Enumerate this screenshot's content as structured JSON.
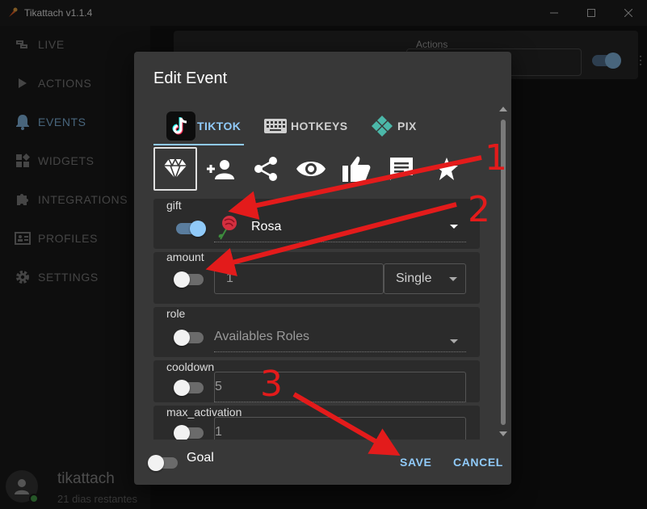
{
  "window": {
    "title": "Tikattach v1.1.4"
  },
  "sidebar": {
    "items": [
      {
        "label": "LIVE",
        "icon": "live-icon"
      },
      {
        "label": "ACTIONS",
        "icon": "play-icon"
      },
      {
        "label": "EVENTS",
        "icon": "bell-icon",
        "active": true
      },
      {
        "label": "WIDGETS",
        "icon": "widgets-icon"
      },
      {
        "label": "INTEGRATIONS",
        "icon": "puzzle-icon"
      },
      {
        "label": "PROFILES",
        "icon": "profile-card-icon"
      },
      {
        "label": "SETTINGS",
        "icon": "gear-icon"
      }
    ],
    "user": {
      "name": "tikattach",
      "info": "21 dias restantes"
    }
  },
  "background": {
    "actions_label": "Actions"
  },
  "dialog": {
    "title": "Edit Event",
    "tabs": [
      {
        "label": "TIKTOK",
        "active": true
      },
      {
        "label": "HOTKEYS"
      },
      {
        "label": "PIX"
      }
    ],
    "fields": {
      "gift": {
        "label": "gift",
        "value": "Rosa",
        "enabled": true
      },
      "amount": {
        "label": "amount",
        "value": "1",
        "mode": "Single",
        "enabled": false
      },
      "role": {
        "label": "role",
        "placeholder": "Availables Roles",
        "enabled": false
      },
      "cooldown": {
        "label": "cooldown",
        "value": "5",
        "enabled": false
      },
      "max_activation": {
        "label": "max_activation",
        "value": "1",
        "enabled": false
      }
    },
    "goal_label": "Goal",
    "save_label": "SAVE",
    "cancel_label": "CANCEL"
  },
  "annotations": [
    "1",
    "2",
    "3"
  ],
  "colors": {
    "accent": "#90caf9",
    "annotation": "#e31b1b",
    "dialog_bg": "#383838"
  }
}
